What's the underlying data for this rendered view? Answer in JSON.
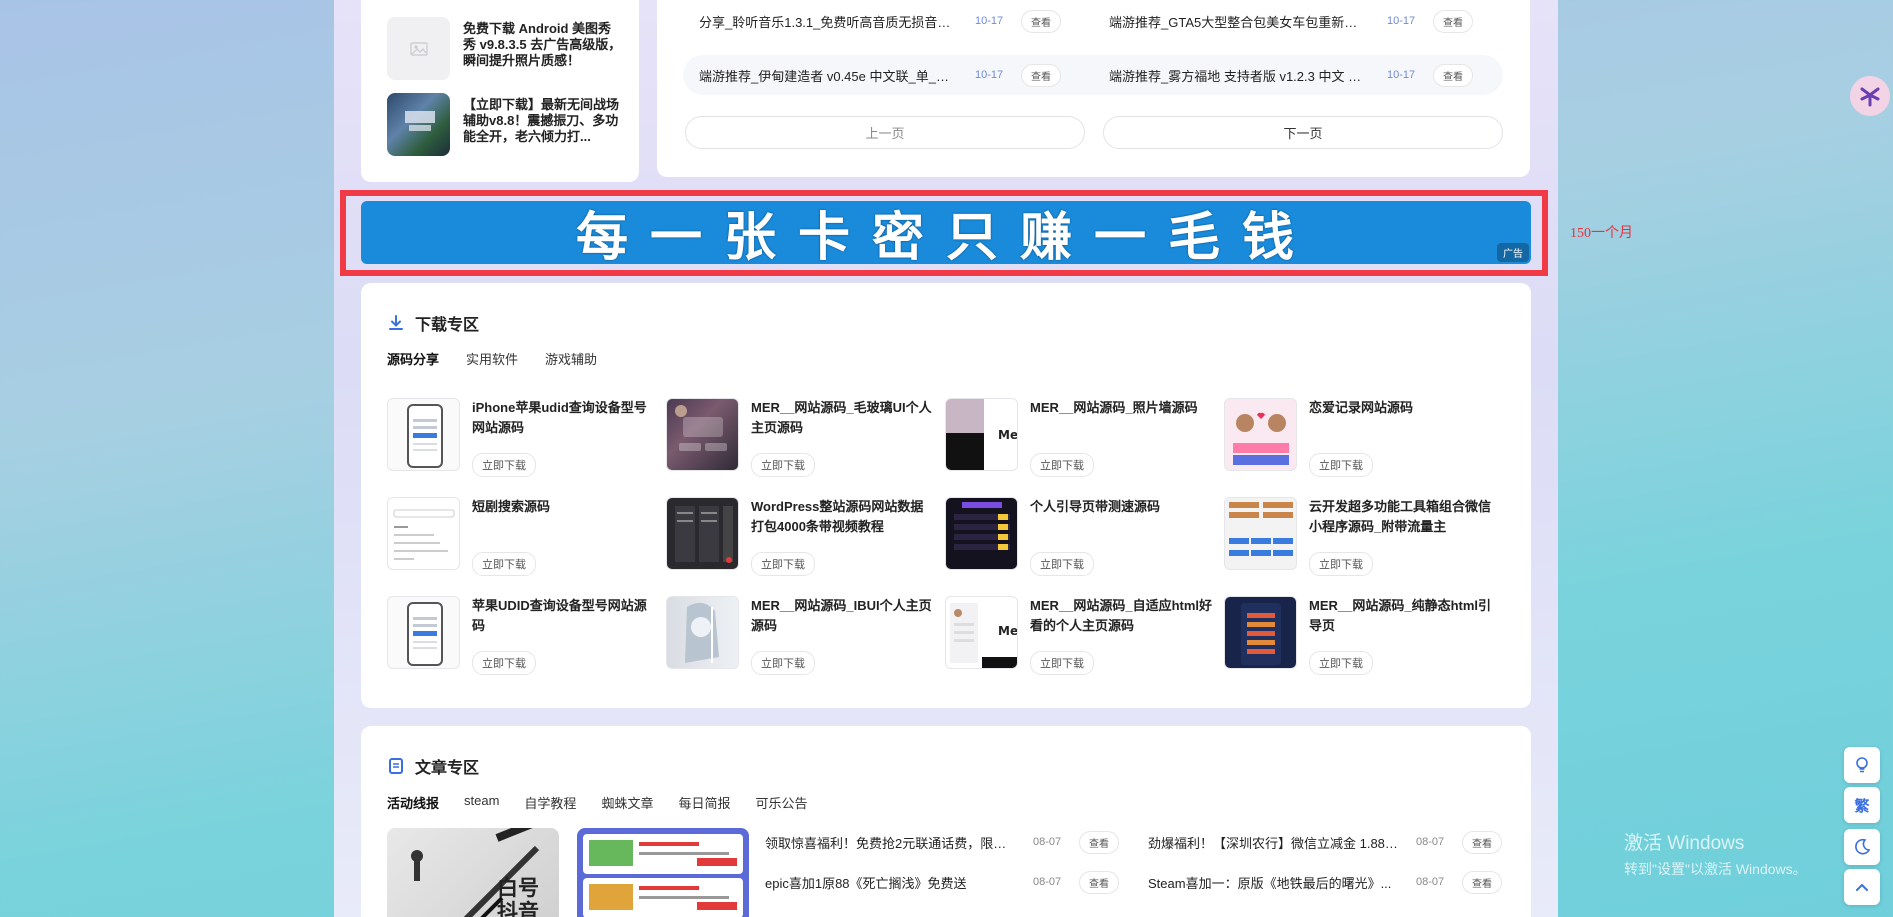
{
  "sidebar_list": [
    {
      "title": "免费下载 Android 美图秀秀 v9.8.3.5 去广告高级版，瞬间提升照片质感！"
    },
    {
      "title": "【立即下载】最新无间战场辅助v8.8！震撼振刀、多功能全开，老六倾力打..."
    }
  ],
  "top_list": {
    "rows": [
      [
        {
          "title": "分享_聆听音乐1.3.1_免费听高音质无损音乐_...",
          "date": "10-17",
          "action": "查看"
        },
        {
          "title": "端游推荐_GTA5大型整合包美女车包重新整合...",
          "date": "10-17",
          "action": "查看"
        }
      ],
      [
        {
          "title": "端游推荐_伊甸建造者 v0.45e 中文联_单_机版",
          "date": "10-17",
          "action": "查看"
        },
        {
          "title": "端游推荐_雾方福地 支持者版 v1.2.3 中文 解...",
          "date": "10-17",
          "action": "查看"
        }
      ]
    ],
    "prev": "上一页",
    "next": "下一页"
  },
  "ad": {
    "text": "每一张卡密只赚一毛钱",
    "tag": "广告",
    "note": "150一个月"
  },
  "download_section": {
    "title": "下载专区",
    "tabs": [
      "源码分享",
      "实用软件",
      "游戏辅助"
    ],
    "action": "立即下载",
    "items": [
      {
        "title": "iPhone苹果udid查询设备型号网站源码"
      },
      {
        "title": "MER__网站源码_毛玻璃UI个人主页源码"
      },
      {
        "title": "MER__网站源码_照片墙源码"
      },
      {
        "title": "恋爱记录网站源码"
      },
      {
        "title": "短剧搜索源码"
      },
      {
        "title": "WordPress整站源码网站数据打包4000条带视频教程"
      },
      {
        "title": "个人引导页带测速源码"
      },
      {
        "title": "云开发超多功能工具箱组合微信小程序源码_附带流量主"
      },
      {
        "title": "苹果UDID查询设备型号网站源码"
      },
      {
        "title": "MER__网站源码_IBUI个人主页源码"
      },
      {
        "title": "MER__网站源码_自适应html好看的个人主页源码"
      },
      {
        "title": "MER__网站源码_纯静态html引导页"
      }
    ]
  },
  "article_section": {
    "title": "文章专区",
    "tabs": [
      "活动线报",
      "steam",
      "自学教程",
      "蜘蛛文章",
      "每日简报",
      "可乐公告"
    ],
    "thumb_text": "白号 抖音",
    "rows": [
      [
        {
          "title": "领取惊喜福利！免费抢2元联通话费，限时...",
          "date": "08-07",
          "action": "查看"
        },
        {
          "title": "劲爆福利！【深圳农行】微信立减金 1.88 ...",
          "date": "08-07",
          "action": "查看"
        }
      ],
      [
        {
          "title": "epic喜加1原88《死亡搁浅》免费送",
          "date": "08-07",
          "action": "查看"
        },
        {
          "title": "Steam喜加一：原版《地铁最后的曙光》...",
          "date": "08-07",
          "action": "查看"
        }
      ]
    ]
  },
  "float_buttons": [
    "bulb-icon",
    "traditional-chinese-button",
    "moon-icon",
    "back-to-top-icon"
  ],
  "float_traditional_label": "繁",
  "watermark": {
    "line1": "激活 Windows",
    "line2": "转到\"设置\"以激活 Windows。"
  }
}
